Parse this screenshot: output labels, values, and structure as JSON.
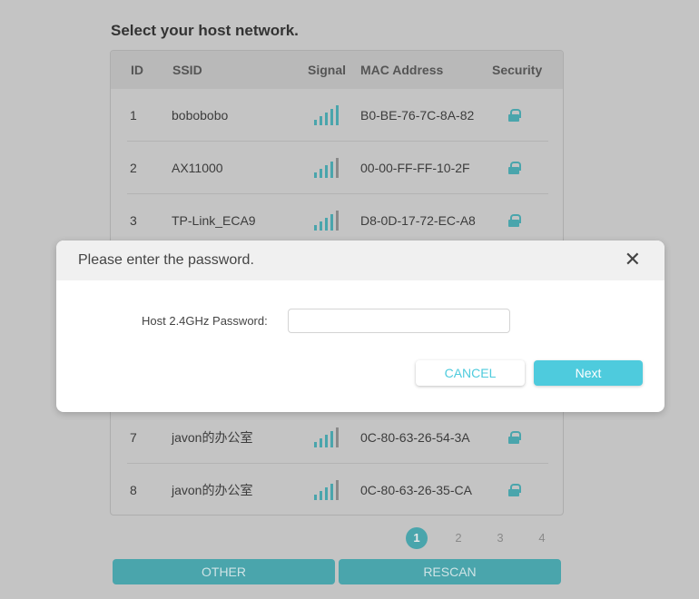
{
  "title": "Select your host network.",
  "table": {
    "headers": {
      "id": "ID",
      "ssid": "SSID",
      "signal": "Signal",
      "mac": "MAC Address",
      "security": "Security"
    },
    "rows": [
      {
        "id": "1",
        "ssid": "bobobobo",
        "signal": 5,
        "mac": "B0-BE-76-7C-8A-82",
        "security": "lock-icon"
      },
      {
        "id": "2",
        "ssid": "AX11000",
        "signal": 4,
        "mac": "00-00-FF-FF-10-2F",
        "security": "lock-icon"
      },
      {
        "id": "3",
        "ssid": "TP-Link_ECA9",
        "signal": 4,
        "mac": "D8-0D-17-72-EC-A8",
        "security": "lock-icon"
      },
      {
        "id": "7",
        "ssid": "javon的办公室",
        "signal": 4,
        "mac": "0C-80-63-26-54-3A",
        "security": "lock-icon"
      },
      {
        "id": "8",
        "ssid": "javon的办公室",
        "signal": 4,
        "mac": "0C-80-63-26-35-CA",
        "security": "lock-icon"
      }
    ]
  },
  "pagination": {
    "pages": [
      "1",
      "2",
      "3",
      "4"
    ],
    "current": "1"
  },
  "buttons": {
    "other": "OTHER",
    "rescan": "RESCAN"
  },
  "modal": {
    "title": "Please enter the password.",
    "close": "✕",
    "label": "Host 2.4GHz Password:",
    "password_value": "",
    "cancel": "CANCEL",
    "next": "Next"
  },
  "colors": {
    "accent": "#4ecbdd",
    "accent_dimmed": "#4aa5ac"
  }
}
